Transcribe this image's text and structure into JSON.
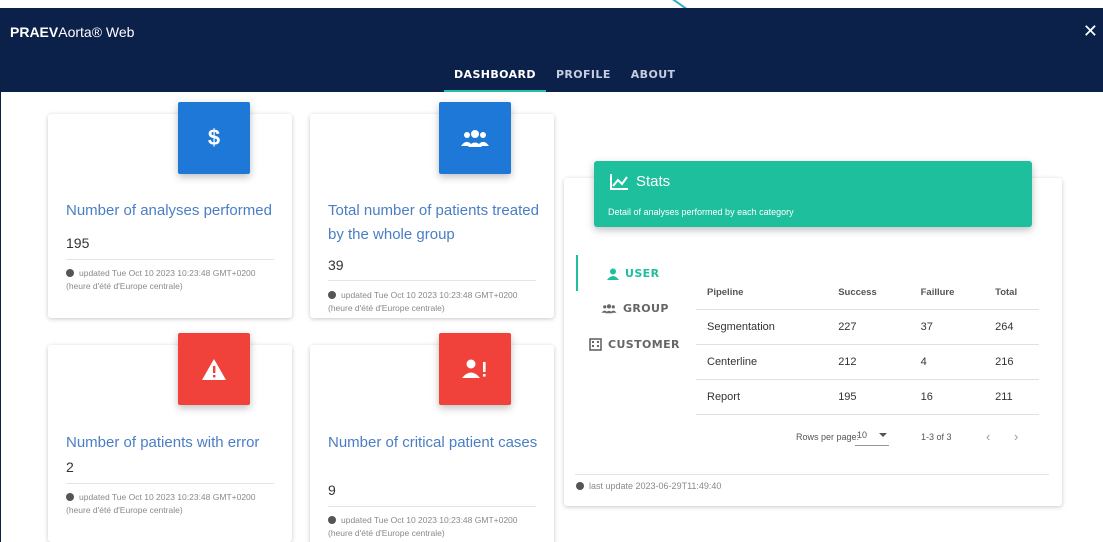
{
  "app": {
    "title_bold": "PRAEV",
    "title_rest": "Aorta® Web",
    "close": "✕"
  },
  "tabs": [
    {
      "label": "DASHBOARD",
      "active": true
    },
    {
      "label": "PROFILE",
      "active": false
    },
    {
      "label": "ABOUT",
      "active": false
    }
  ],
  "cards": [
    {
      "icon": "dollar-icon",
      "color": "#1e78d8",
      "title": "Number of analyses performed",
      "value": "195",
      "updated": "updated Tue Oct 10 2023 10:23:48 GMT+0200 (heure d'été d'Europe centrale)"
    },
    {
      "icon": "group-icon",
      "color": "#1e78d8",
      "title": "Total number of patients treated by the whole group",
      "value": "39",
      "updated": "updated Tue Oct 10 2023 10:23:48 GMT+0200 (heure d'été d'Europe centrale)"
    },
    {
      "icon": "warning-icon",
      "color": "#f0413a",
      "title": "Number of patients with error",
      "value": "2",
      "updated": "updated Tue Oct 10 2023 10:23:48 GMT+0200 (heure d'été d'Europe centrale)"
    },
    {
      "icon": "critical-patient-icon",
      "color": "#f0413a",
      "title": "Number of critical patient cases",
      "value": "9",
      "updated": "updated Tue Oct 10 2023 10:23:48 GMT+0200 (heure d'été d'Europe centrale)"
    }
  ],
  "stats": {
    "title": "Stats",
    "description": "Detail of analyses performed by each category",
    "menu": [
      {
        "label": "USER",
        "icon": "user-icon",
        "active": true
      },
      {
        "label": "GROUP",
        "icon": "group-icon",
        "active": false
      },
      {
        "label": "CUSTOMER",
        "icon": "building-icon",
        "active": false
      }
    ],
    "columns": [
      "Pipeline",
      "Success",
      "Faillure",
      "Total"
    ],
    "rows": [
      [
        "Segmentation",
        "227",
        "37",
        "264"
      ],
      [
        "Centerline",
        "212",
        "4",
        "216"
      ],
      [
        "Report",
        "195",
        "16",
        "211"
      ]
    ],
    "rows_per_page_label": "Rows per page:",
    "rows_per_page": "10",
    "range": "1-3 of 3",
    "last_update": "last update 2023-06-29T11:49:40"
  },
  "colors": {
    "navbar": "#0c2149",
    "accent": "#1dbf9c",
    "blue_tile": "#1e78d8",
    "red_tile": "#f0413a"
  }
}
